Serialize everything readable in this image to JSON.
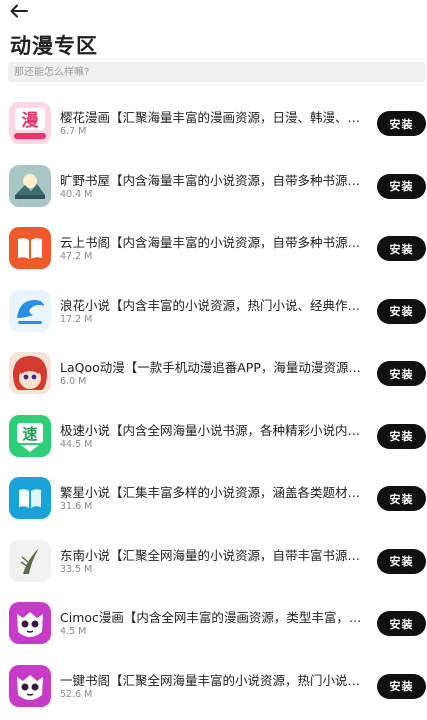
{
  "header": {
    "title": "动漫专区",
    "back_icon": "arrow-left-icon"
  },
  "search": {
    "placeholder": "那还能怎么样嘛?"
  },
  "install_label": "安装",
  "apps": [
    {
      "name": "樱花漫画【汇聚海量丰富的漫画资源，日漫、韩漫、国漫…",
      "size": "6.7 M",
      "icon": "sakura-manga-icon",
      "bg": "#ffd6e4",
      "accent": "#e8336d"
    },
    {
      "name": "旷野书屋【内含海量丰富的小说资源，自带多种书源，…",
      "size": "40.4 M",
      "icon": "wilderness-book-icon",
      "bg": "#a9c7c2",
      "accent": "#3d6f70"
    },
    {
      "name": "云上书阁【内含海量丰富的小说资源，自带多种书源，…",
      "size": "47.2 M",
      "icon": "cloud-book-icon",
      "bg": "#ef5a2a",
      "accent": "#ffffff"
    },
    {
      "name": "浪花小说【内含丰富的小说资源，热门小说、经典作品…",
      "size": "17.2 M",
      "icon": "wave-novel-icon",
      "bg": "#eaf4fb",
      "accent": "#2b8fe0"
    },
    {
      "name": "LaQoo动漫【一款手机动漫追番APP，海量动漫资源，…",
      "size": "6.0 M",
      "icon": "laqoo-anime-icon",
      "bg": "#f4e3d8",
      "accent": "#d63a2f"
    },
    {
      "name": "极速小说【内含全网海量小说书源，各种精彩小说内容…",
      "size": "44.5 M",
      "icon": "speed-novel-icon",
      "bg": "#2fcf7a",
      "accent": "#ffffff"
    },
    {
      "name": "繁星小说【汇集丰富多样的小说资源，涵盖各类题材和…",
      "size": "31.6 M",
      "icon": "stars-novel-icon",
      "bg": "#1aa3d9",
      "accent": "#ffffff"
    },
    {
      "name": "东南小说【汇聚全网海量的小说资源，自带丰富书源，…",
      "size": "33.5 M",
      "icon": "southeast-novel-icon",
      "bg": "#f1f1f1",
      "accent": "#5a6b45"
    },
    {
      "name": "Cimoc漫画【内含全网丰富的漫画资源，类型丰富，解…",
      "size": "4.5 M",
      "icon": "cimoc-manga-icon",
      "bg": "#c63cc9",
      "accent": "#ffffff"
    },
    {
      "name": "一键书阁【汇聚全网海量丰富的小说资源，热门小说、…",
      "size": "52.6 M",
      "icon": "onekey-book-icon",
      "bg": "#c63cc9",
      "accent": "#ffffff"
    }
  ]
}
